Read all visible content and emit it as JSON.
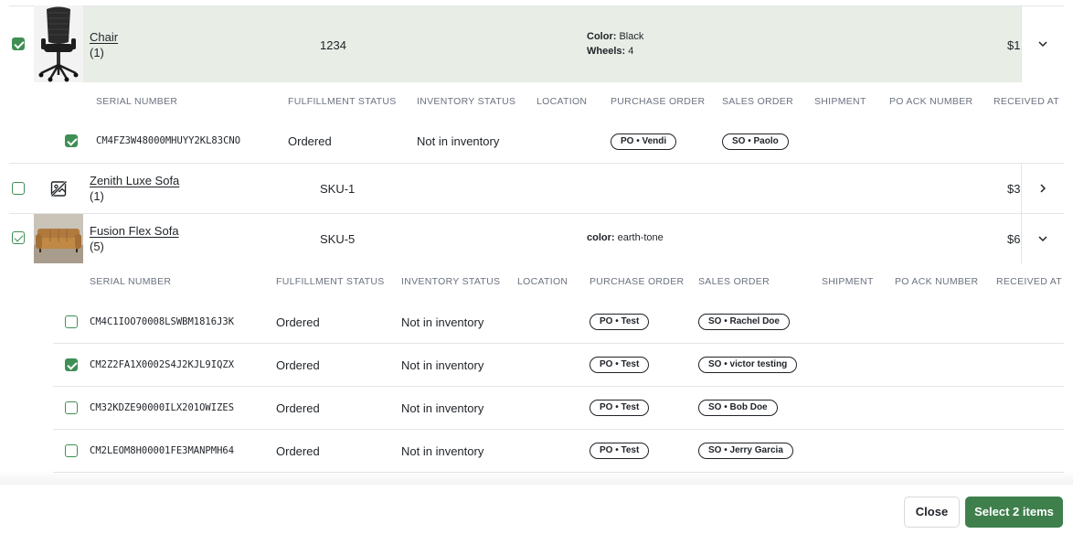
{
  "colors": {
    "accent": "#3f7f4c",
    "checkbox": "#3f8f55",
    "highlight_row": "#e8ede6"
  },
  "products": [
    {
      "name": "Chair",
      "qty": "(1)",
      "sku": "1234",
      "attr1_label": "Color:",
      "attr1_value": " Black",
      "attr2_label": "Wheels:",
      "attr2_value": " 4",
      "price": "$1",
      "checked": true,
      "expanded": true,
      "image": "chair-image"
    },
    {
      "name": "Zenith Luxe Sofa",
      "qty": "(1)",
      "sku": "SKU-1",
      "price": "$3",
      "checked": false,
      "expanded": false,
      "image": "image-placeholder-icon"
    },
    {
      "name": "Fusion Flex Sofa",
      "qty": "(5)",
      "sku": "SKU-5",
      "attr1_label": "color:",
      "attr1_value": " earth-tone",
      "price": "$6",
      "checked": true,
      "expanded": true,
      "image": "sofa-image"
    }
  ],
  "serial_headers": {
    "serial_number": "SERIAL NUMBER",
    "fulfillment_status": "FULFILLMENT STATUS",
    "inventory_status": "INVENTORY STATUS",
    "location": "LOCATION",
    "purchase_order": "PURCHASE ORDER",
    "sales_order": "SALES ORDER",
    "shipment": "SHIPMENT",
    "po_ack_number": "PO ACK NUMBER",
    "received_at": "RECEIVED AT"
  },
  "chair_serials": [
    {
      "serial": "CM4FZ3W48000MHUYY2KL83CNO",
      "fulfillment": "Ordered",
      "inventory": "Not in inventory",
      "po": "PO • Vendi",
      "so": "SO • Paolo",
      "checked": true
    }
  ],
  "sofa_serials": [
    {
      "serial": "CM4C1IOO70008LSWBM1816J3K",
      "fulfillment": "Ordered",
      "inventory": "Not in inventory",
      "po": "PO • Test",
      "so": "SO • Rachel Doe",
      "checked": false
    },
    {
      "serial": "CM2Z2FA1X0002S4J2KJL9IQZX",
      "fulfillment": "Ordered",
      "inventory": "Not in inventory",
      "po": "PO • Test",
      "so": "SO • victor testing",
      "checked": true
    },
    {
      "serial": "CM32KDZE90000ILX201OWIZES",
      "fulfillment": "Ordered",
      "inventory": "Not in inventory",
      "po": "PO • Test",
      "so": "SO • Bob Doe",
      "checked": false
    },
    {
      "serial": "CM2LEOM8H00001FE3MANPMH64",
      "fulfillment": "Ordered",
      "inventory": "Not in inventory",
      "po": "PO • Test",
      "so": "SO • Jerry Garcia",
      "checked": false
    }
  ],
  "footer": {
    "close_label": "Close",
    "select_label": "Select 2 items"
  }
}
